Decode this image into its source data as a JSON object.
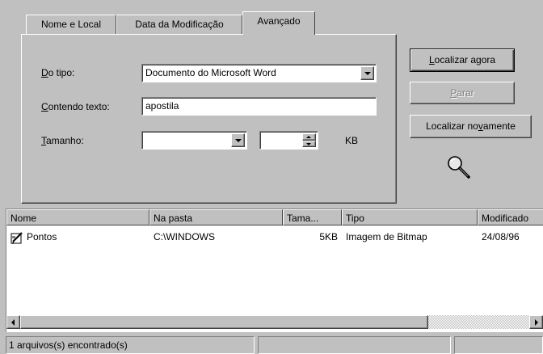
{
  "tabs": [
    {
      "label": "Nome e Local",
      "active": false
    },
    {
      "label": "Data da Modificação",
      "active": false
    },
    {
      "label": "Avançado",
      "active": true
    }
  ],
  "form": {
    "type_label_mn": "D",
    "type_label_rest": "o tipo:",
    "type_value": "Documento do Microsoft Word",
    "text_label_mn": "C",
    "text_label_rest": "ontendo texto:",
    "text_value": "apostila",
    "size_label_mn": "T",
    "size_label_rest": "amanho:",
    "size_value": "",
    "size_number": "",
    "size_unit": "KB"
  },
  "buttons": {
    "find_now_mn": "L",
    "find_now_rest": "ocalizar agora",
    "stop_mn": "P",
    "stop_rest": "arar",
    "new_search_pre": "Localizar no",
    "new_search_mn": "v",
    "new_search_post": "amente"
  },
  "results": {
    "columns": [
      "Nome",
      "Na pasta",
      "Tama...",
      "Tipo",
      "Modificado"
    ],
    "rows": [
      {
        "name": "Pontos",
        "folder": "C:\\WINDOWS",
        "size": "5KB",
        "type": "Imagem de Bitmap",
        "modified": "24/08/96"
      }
    ]
  },
  "status": {
    "text": "1 arquivos(s) encontrado(s)"
  },
  "icons": {
    "magnifier": "magnifier-icon",
    "bitmap_file": "bitmap-file-icon"
  }
}
